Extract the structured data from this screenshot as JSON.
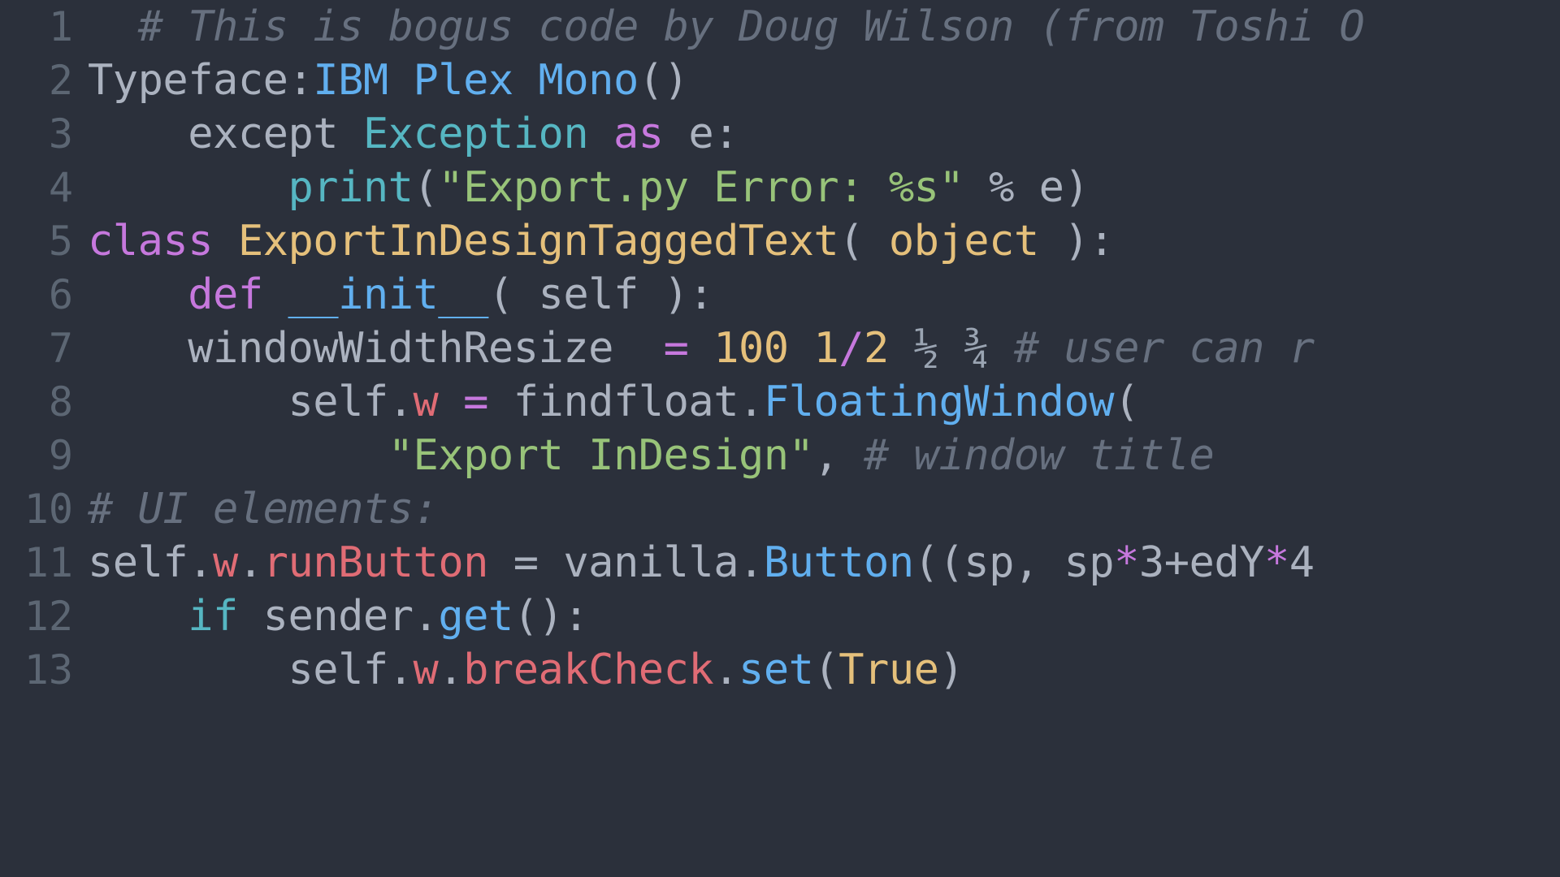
{
  "editor": {
    "background_color": "#2b303b",
    "gutter_color": "#5c6673",
    "language": "python",
    "font_size_px": 52,
    "line_height_px": 66,
    "total_lines": 13,
    "first_visible_line": 1,
    "last_visible_line": 13,
    "horizontal_overflow": true
  },
  "palette": {
    "default": "#abb2bf",
    "comment": "#67707f",
    "string": "#98c379",
    "keyword": "#c678dd",
    "builtin": "#56b6c2",
    "function": "#61afef",
    "class_name": "#e5c07b",
    "number": "#e5c07b",
    "property": "#e06c75",
    "operator": "#c678dd",
    "fraction": "#9aa4b2"
  },
  "gutter": {
    "numbers": [
      "1",
      "2",
      "3",
      "4",
      "5",
      "6",
      "7",
      "8",
      "9",
      "10",
      "11",
      "12",
      "13"
    ]
  },
  "lines": [
    {
      "number": "1",
      "plain": "# This is bogus code by Doug Wilson (from Toshi O",
      "tokens": [
        {
          "text": "  ",
          "type": "default"
        },
        {
          "text": "# This is bogus code by Doug Wilson (from Toshi O",
          "type": "comment"
        }
      ]
    },
    {
      "number": "2",
      "plain": "Typeface:IBM Plex Mono()",
      "tokens": [
        {
          "text": "Typeface:",
          "type": "default"
        },
        {
          "text": "IBM Plex Mono",
          "type": "function"
        },
        {
          "text": "()",
          "type": "punct"
        }
      ]
    },
    {
      "number": "3",
      "plain": "    except Exception as e:",
      "tokens": [
        {
          "text": "    except ",
          "type": "default"
        },
        {
          "text": "Exception",
          "type": "builtin"
        },
        {
          "text": " ",
          "type": "default"
        },
        {
          "text": "as",
          "type": "keyword"
        },
        {
          "text": " e:",
          "type": "default"
        }
      ]
    },
    {
      "number": "4",
      "plain": "        print(\"Export.py Error: %s\" % e)",
      "tokens": [
        {
          "text": "        ",
          "type": "default"
        },
        {
          "text": "print",
          "type": "builtin"
        },
        {
          "text": "(",
          "type": "punct"
        },
        {
          "text": "\"Export.py Error: %s\"",
          "type": "string"
        },
        {
          "text": " % e)",
          "type": "default"
        }
      ]
    },
    {
      "number": "5",
      "plain": "class ExportInDesignTaggedText( object ):",
      "tokens": [
        {
          "text": "class",
          "type": "keyword"
        },
        {
          "text": " ",
          "type": "default"
        },
        {
          "text": "ExportInDesignTaggedText",
          "type": "class_name"
        },
        {
          "text": "( ",
          "type": "punct"
        },
        {
          "text": "object",
          "type": "class_name"
        },
        {
          "text": " ):",
          "type": "punct"
        }
      ]
    },
    {
      "number": "6",
      "plain": "    def __init__( self ):",
      "tokens": [
        {
          "text": "    ",
          "type": "default"
        },
        {
          "text": "def",
          "type": "keyword"
        },
        {
          "text": " ",
          "type": "default"
        },
        {
          "text": "__init__",
          "type": "function"
        },
        {
          "text": "( self ):",
          "type": "default"
        }
      ]
    },
    {
      "number": "7",
      "plain": "    windowWidthResize  = 100 1/2 ½ ¾ # user can r",
      "tokens": [
        {
          "text": "    windowWidthResize  ",
          "type": "default"
        },
        {
          "text": "=",
          "type": "operator"
        },
        {
          "text": " ",
          "type": "default"
        },
        {
          "text": "100",
          "type": "number"
        },
        {
          "text": " ",
          "type": "default"
        },
        {
          "text": "1",
          "type": "number"
        },
        {
          "text": "/",
          "type": "operator"
        },
        {
          "text": "2",
          "type": "number"
        },
        {
          "text": " ",
          "type": "default"
        },
        {
          "text": "½ ¾",
          "type": "fraction"
        },
        {
          "text": " ",
          "type": "default"
        },
        {
          "text": "# user can r",
          "type": "comment"
        }
      ]
    },
    {
      "number": "8",
      "plain": "        self.w = findfloat.FloatingWindow(",
      "tokens": [
        {
          "text": "        self.",
          "type": "default"
        },
        {
          "text": "w",
          "type": "property"
        },
        {
          "text": " ",
          "type": "default"
        },
        {
          "text": "=",
          "type": "operator"
        },
        {
          "text": " findfloat.",
          "type": "default"
        },
        {
          "text": "FloatingWindow",
          "type": "function"
        },
        {
          "text": "(",
          "type": "punct"
        }
      ]
    },
    {
      "number": "9",
      "plain": "            \"Export InDesign\", # window title",
      "tokens": [
        {
          "text": "            ",
          "type": "default"
        },
        {
          "text": "\"Export InDesign\"",
          "type": "string"
        },
        {
          "text": ", ",
          "type": "punct"
        },
        {
          "text": "# window title",
          "type": "comment"
        }
      ]
    },
    {
      "number": "10",
      "plain": "# UI elements:",
      "tokens": [
        {
          "text": "# UI elements:",
          "type": "comment"
        }
      ]
    },
    {
      "number": "11",
      "plain": "self.w.runButton = vanilla.Button((sp, sp*3+edY*4",
      "tokens": [
        {
          "text": "self.",
          "type": "default"
        },
        {
          "text": "w",
          "type": "property"
        },
        {
          "text": ".",
          "type": "default"
        },
        {
          "text": "runButton",
          "type": "property"
        },
        {
          "text": " = vanilla.",
          "type": "default"
        },
        {
          "text": "Button",
          "type": "function"
        },
        {
          "text": "((sp, sp",
          "type": "default"
        },
        {
          "text": "*",
          "type": "operator"
        },
        {
          "text": "3+edY",
          "type": "default"
        },
        {
          "text": "*",
          "type": "operator"
        },
        {
          "text": "4",
          "type": "default"
        }
      ]
    },
    {
      "number": "12",
      "plain": "    if sender.get():",
      "tokens": [
        {
          "text": "    ",
          "type": "default"
        },
        {
          "text": "if",
          "type": "builtin"
        },
        {
          "text": " sender.",
          "type": "default"
        },
        {
          "text": "get",
          "type": "function"
        },
        {
          "text": "():",
          "type": "default"
        }
      ]
    },
    {
      "number": "13",
      "plain": "        self.w.breakCheck.set(True)",
      "tokens": [
        {
          "text": "        self.",
          "type": "default"
        },
        {
          "text": "w",
          "type": "property"
        },
        {
          "text": ".",
          "type": "default"
        },
        {
          "text": "breakCheck",
          "type": "property"
        },
        {
          "text": ".",
          "type": "default"
        },
        {
          "text": "set",
          "type": "function"
        },
        {
          "text": "(",
          "type": "punct"
        },
        {
          "text": "True",
          "type": "class_name"
        },
        {
          "text": ")",
          "type": "punct"
        }
      ]
    }
  ]
}
